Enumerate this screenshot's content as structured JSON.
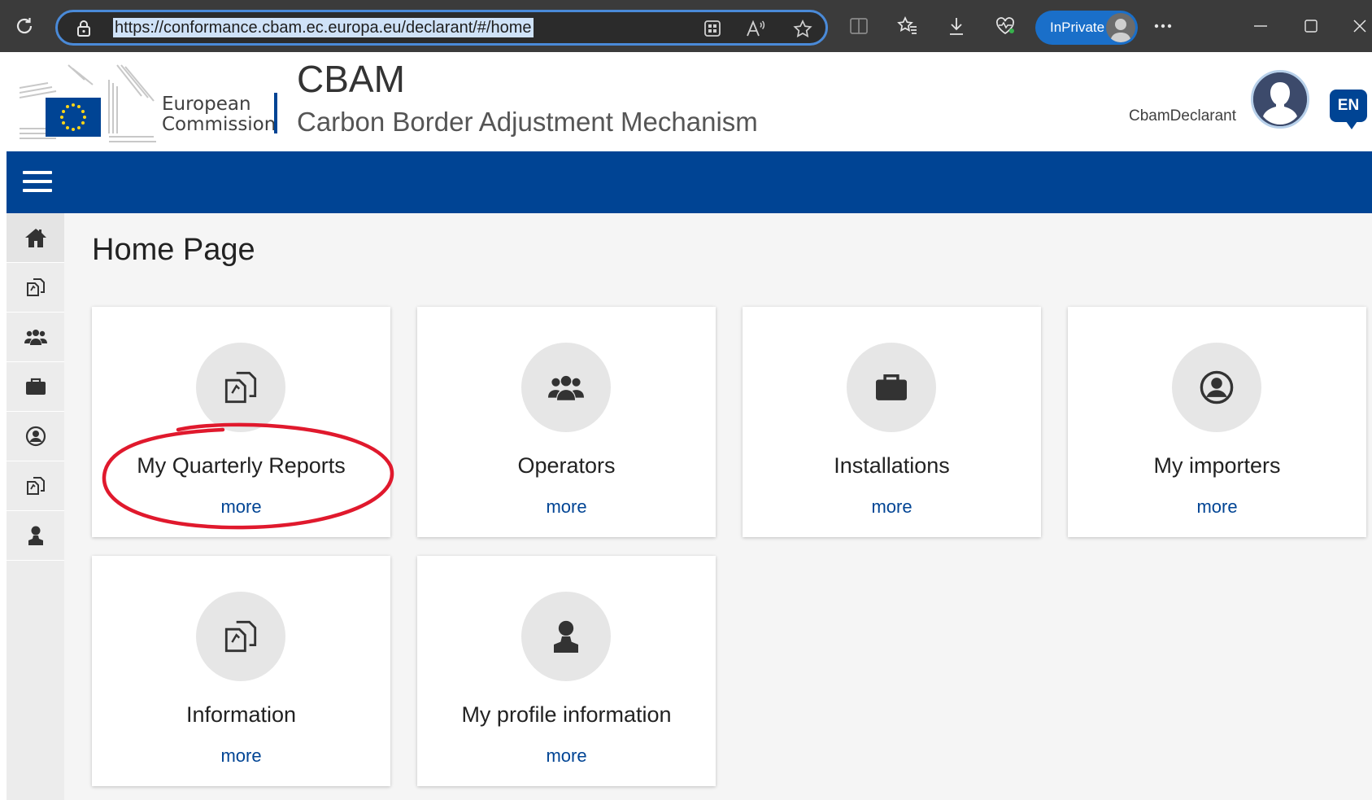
{
  "browser": {
    "url": "https://conformance.cbam.ec.europa.eu/declarant/#/home",
    "inprivate_label": "InPrivate",
    "icons": [
      "refresh-icon",
      "lock-icon",
      "app-available-icon",
      "read-aloud-icon",
      "favorite-icon",
      "split-screen-icon",
      "favorites-icon",
      "downloads-icon",
      "browser-essentials-icon",
      "more-icon",
      "minimize-icon",
      "maximize-icon",
      "close-icon"
    ]
  },
  "header": {
    "org_name_line1": "European",
    "org_name_line2": "Commission",
    "app_title": "CBAM",
    "app_subtitle": "Carbon Border Adjustment Mechanism",
    "username": "CbamDeclarant",
    "language": "EN"
  },
  "colors": {
    "primary": "#004494",
    "highlight": "#e0192d",
    "card_icon_bg": "#e6e6e6",
    "page_bg": "#f5f5f5"
  },
  "sidebar": {
    "items": [
      {
        "icon": "home-icon",
        "active": true
      },
      {
        "icon": "documents-icon"
      },
      {
        "icon": "users-icon"
      },
      {
        "icon": "briefcase-icon"
      },
      {
        "icon": "user-circle-icon"
      },
      {
        "icon": "documents-icon"
      },
      {
        "icon": "person-icon"
      }
    ]
  },
  "main": {
    "title": "Home Page",
    "more_label": "more",
    "cards": [
      {
        "title": "My Quarterly Reports",
        "icon": "documents-icon",
        "highlighted": true
      },
      {
        "title": "Operators",
        "icon": "users-icon"
      },
      {
        "title": "Installations",
        "icon": "briefcase-icon"
      },
      {
        "title": "My importers",
        "icon": "user-circle-icon"
      },
      {
        "title": "Information",
        "icon": "documents-icon"
      },
      {
        "title": "My profile information",
        "icon": "person-icon"
      }
    ]
  }
}
